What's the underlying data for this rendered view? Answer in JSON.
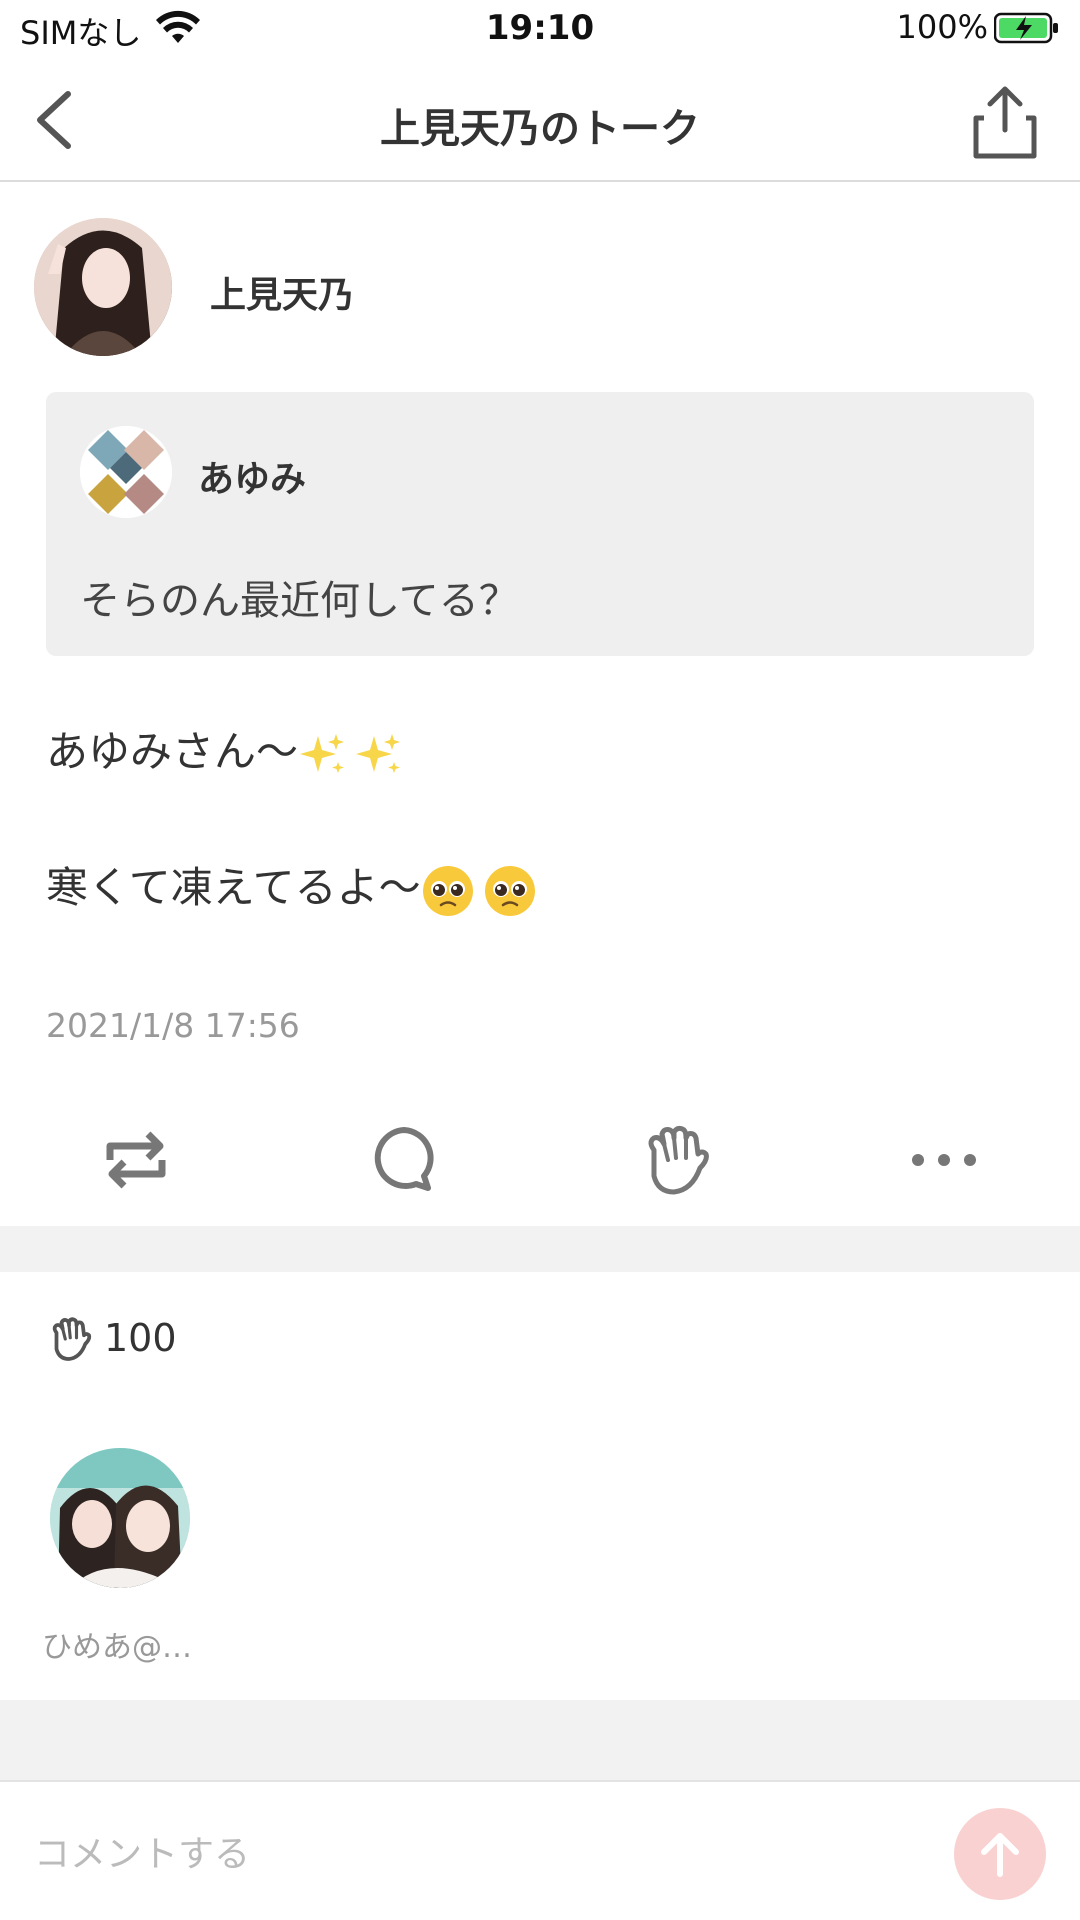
{
  "status_bar": {
    "carrier": "SIMなし",
    "time": "19:10",
    "battery_percent": "100%",
    "battery_color": "#4cd964"
  },
  "nav": {
    "title": "上見天乃のトーク",
    "back_icon": "chevron-left-icon",
    "share_icon": "share-icon"
  },
  "post": {
    "author": "上見天乃",
    "quote": {
      "author": "あゆみ",
      "text": "そらのん最近何してる？"
    },
    "lines": [
      {
        "text": "あゆみさん〜",
        "emoji": [
          "sparkles",
          "sparkles"
        ]
      },
      {
        "text": "寒くて凍えてるよ〜",
        "emoji": [
          "pleading-face",
          "pleading-face"
        ]
      }
    ],
    "timestamp": "2021/1/8 17:56"
  },
  "actions": [
    {
      "name": "repost-icon"
    },
    {
      "name": "comment-icon"
    },
    {
      "name": "clap-icon"
    },
    {
      "name": "more-icon"
    }
  ],
  "reactions": {
    "clap_count": "100",
    "users": [
      {
        "name": "ひめあ@…"
      }
    ]
  },
  "comment": {
    "placeholder": "コメントする",
    "send_color": "#f9d1d1"
  }
}
